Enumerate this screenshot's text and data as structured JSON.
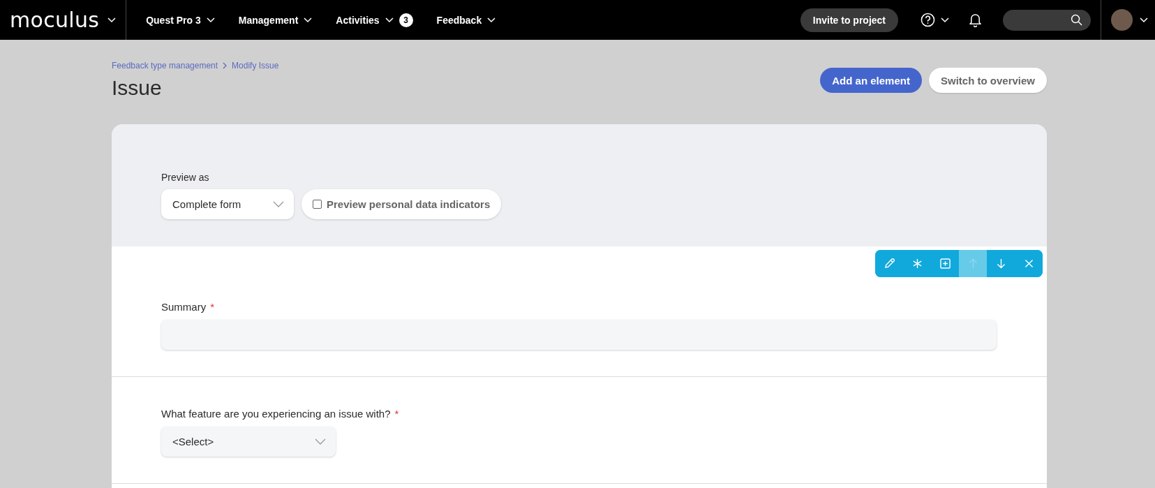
{
  "nav": {
    "logo": "moculus",
    "items": [
      {
        "label": "Quest Pro 3"
      },
      {
        "label": "Management"
      },
      {
        "label": "Activities",
        "badge": "3"
      },
      {
        "label": "Feedback"
      }
    ],
    "invite_button": "Invite to project"
  },
  "breadcrumb": [
    "Feedback type management",
    "Modify Issue"
  ],
  "title": "Issue",
  "actions": [
    {
      "label": "Add an element",
      "kind": "primary"
    },
    {
      "label": "Switch to overview",
      "kind": "secondary"
    }
  ],
  "preview": {
    "label": "Preview as",
    "select_value": "Complete form",
    "checkbox": {
      "label": "Preview personal data indicators",
      "checked": false
    }
  },
  "toolbar": [
    {
      "kind": "edit",
      "disabled": false
    },
    {
      "kind": "required",
      "disabled": false
    },
    {
      "kind": "add",
      "disabled": false
    },
    {
      "kind": "up",
      "disabled": true
    },
    {
      "kind": "down",
      "disabled": false
    },
    {
      "kind": "remove",
      "disabled": false
    }
  ],
  "fields": [
    {
      "label": "Summary",
      "required_mark": "*",
      "kind": "text"
    },
    {
      "label": "What feature are you experiencing an issue with?",
      "required_mark": "*",
      "kind": "select",
      "value": "<Select>"
    }
  ]
}
